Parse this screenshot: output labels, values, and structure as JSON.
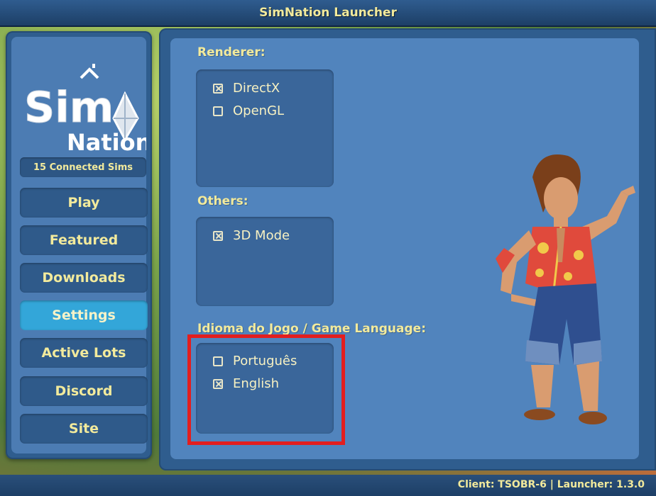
{
  "window": {
    "title": "SimNation Launcher"
  },
  "sidebar": {
    "logo": {
      "line1": "Sim",
      "line2": "Nation"
    },
    "connected_label": "15 Connected Sims",
    "items": [
      {
        "label": "Play",
        "active": false
      },
      {
        "label": "Featured",
        "active": false
      },
      {
        "label": "Downloads",
        "active": false
      },
      {
        "label": "Settings",
        "active": true
      },
      {
        "label": "Active Lots",
        "active": false
      },
      {
        "label": "Discord",
        "active": false
      },
      {
        "label": "Site",
        "active": false
      }
    ]
  },
  "settings": {
    "renderer": {
      "label": "Renderer:",
      "options": [
        {
          "label": "DirectX",
          "checked": true
        },
        {
          "label": "OpenGL",
          "checked": false
        }
      ]
    },
    "others": {
      "label": "Others:",
      "options": [
        {
          "label": "3D Mode",
          "checked": true
        }
      ]
    },
    "language": {
      "label": "Idioma do Jogo / Game Language:",
      "options": [
        {
          "label": "Português",
          "checked": false
        },
        {
          "label": "English",
          "checked": true
        }
      ]
    }
  },
  "status": {
    "text": "Client: TSOBR-6 | Launcher: 1.3.0"
  },
  "colors": {
    "accent_text": "#f2ea9c",
    "active_button": "#33a6d9",
    "highlight_border": "#e31e1e"
  }
}
